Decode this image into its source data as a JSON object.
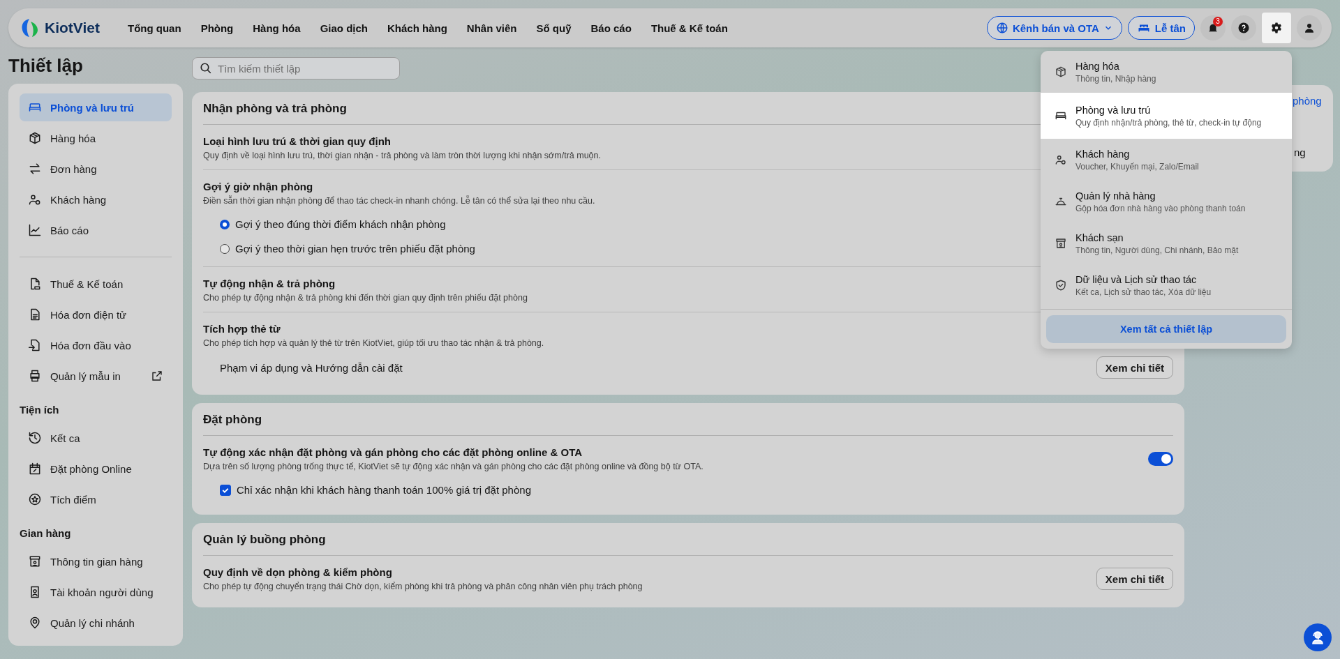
{
  "nav": {
    "logo": "KiotViet",
    "menu": [
      {
        "label": "Tổng quan"
      },
      {
        "label": "Phòng"
      },
      {
        "label": "Hàng hóa"
      },
      {
        "label": "Giao dịch"
      },
      {
        "label": "Khách hàng"
      },
      {
        "label": "Nhân viên"
      },
      {
        "label": "Sổ quỹ"
      },
      {
        "label": "Báo cáo"
      },
      {
        "label": "Thuế & Kế toán"
      }
    ],
    "channel_button": "Kênh bán và OTA",
    "reception_button": "Lễ tân",
    "notification_count": "3",
    "settings_selected": true
  },
  "page_title": "Thiết lập",
  "search": {
    "placeholder": "Tìm kiếm thiết lập"
  },
  "sidebar": [
    {
      "items": [
        {
          "label": "Phòng và lưu trú",
          "selected": true
        },
        {
          "label": "Hàng hóa",
          "selected": false
        },
        {
          "label": "Đơn hàng",
          "selected": false
        },
        {
          "label": "Khách hàng",
          "selected": false
        },
        {
          "label": "Báo cáo",
          "selected": false
        }
      ]
    },
    {
      "items": [
        {
          "label": "Thuế & Kế toán",
          "selected": false
        },
        {
          "label": "Hóa đơn điện tử",
          "selected": false
        },
        {
          "label": "Hóa đơn đầu vào",
          "selected": false
        },
        {
          "label": "Quản lý mẫu in",
          "selected": false,
          "external": true
        }
      ]
    },
    {
      "heading": "Tiện ích",
      "items": [
        {
          "label": "Kết ca",
          "selected": false
        },
        {
          "label": "Đặt phòng Online",
          "selected": false
        },
        {
          "label": "Tích điểm",
          "selected": false
        }
      ]
    },
    {
      "heading": "Gian hàng",
      "items": [
        {
          "label": "Thông tin gian hàng",
          "selected": false
        },
        {
          "label": "Tài khoản người dùng",
          "selected": false
        },
        {
          "label": "Quản lý chi nhánh",
          "selected": false
        }
      ]
    }
  ],
  "sections": [
    {
      "title": "Nhận phòng và trả phòng",
      "rows": [
        {
          "title": "Loại hình lưu trú & thời gian quy định",
          "description": "Quy định về loại hình lưu trú, thời gian nhận - trả phòng và làm tròn thời lượng khi nhận sớm/trả muộn."
        },
        {
          "title": "Gợi ý giờ nhận phòng",
          "description": "Điền sẵn thời gian nhận phòng để thao tác check-in nhanh chóng. Lễ tân có thể sửa lại theo nhu cầu.",
          "options": [
            {
              "label": "Gợi ý theo đúng thời điểm khách nhận phòng",
              "selected": true
            },
            {
              "label": "Gợi ý theo thời gian hẹn trước trên phiếu đặt phòng",
              "selected": false
            }
          ]
        },
        {
          "title": "Tự động nhận & trả phòng",
          "description": "Cho phép tự động nhận & trả phòng khi đến thời gian quy định trên phiếu đặt phòng"
        },
        {
          "title": "Tích hợp thẻ từ",
          "description": "Cho phép tích hợp và quản lý thẻ từ trên KiotViet, giúp tối ưu thao tác nhận & trả phòng.",
          "sub": {
            "label": "Phạm vi áp dụng và Hướng dẫn cài đặt",
            "button": "Xem chi tiết"
          }
        }
      ]
    },
    {
      "title": "Đặt phòng",
      "rows": [
        {
          "title": "Tự động xác nhận đặt phòng và gán phòng cho các đặt phòng online & OTA",
          "description": "Dựa trên số lượng phòng trống thực tế, KiotViet sẽ tự động xác nhận và gán phòng cho các đặt phòng online và đồng bộ từ OTA.",
          "toggle": {
            "on": true
          },
          "checkbox": {
            "label": "Chỉ xác nhận khi khách hàng thanh toán 100% giá trị đặt phòng",
            "checked": true
          }
        }
      ]
    },
    {
      "title": "Quản lý buồng phòng",
      "rows": [
        {
          "title": "Quy định về dọn phòng & kiểm phòng",
          "description": "Cho phép tự động chuyển trạng thái Chờ dọn, kiểm phòng khi trả phòng và phân công nhân viên phụ trách phòng",
          "button": "Xem chi tiết"
        }
      ]
    }
  ],
  "side_card": {
    "fragments": [
      "phòng",
      "ng"
    ]
  },
  "settings_menu": {
    "items": [
      {
        "title": "Hàng hóa",
        "subtitle": "Thông tin, Nhập hàng",
        "selected": false
      },
      {
        "title": "Phòng và lưu trú",
        "subtitle": "Quy định nhận/trả phòng, thẻ từ, check-in tự động",
        "selected": true
      },
      {
        "title": "Khách hàng",
        "subtitle": "Voucher, Khuyến mại, Zalo/Email",
        "selected": false
      },
      {
        "title": "Quản lý nhà hàng",
        "subtitle": "Gộp hóa đơn nhà hàng vào phòng thanh toán",
        "selected": false
      },
      {
        "title": "Khách sạn",
        "subtitle": "Thông tin, Người dùng, Chi nhánh, Bảo mật",
        "selected": false
      },
      {
        "title": "Dữ liệu và Lịch sử thao tác",
        "subtitle": "Kết ca, Lịch sử thao tác, Xóa dữ liệu",
        "selected": false
      }
    ],
    "footer_button": "Xem tất cả thiết lập"
  }
}
